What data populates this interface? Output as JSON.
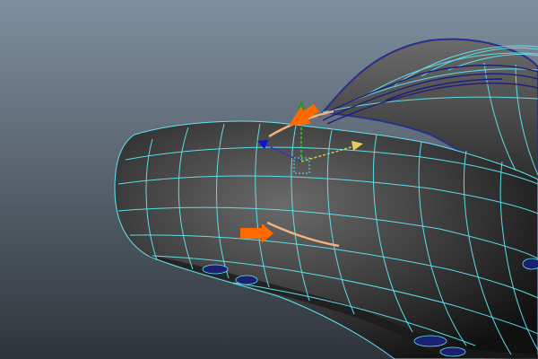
{
  "viewport": {
    "background_top": "#7f8f9f",
    "background_bottom": "#2f3439"
  },
  "mesh": {
    "object": "saddle-surface-mesh",
    "wireframe_color": "#5fe6f2",
    "shaded_color": "#4b4b4b",
    "selected_curve_color": "#f2b17f",
    "edge_highlight_color": "#2a2f8a",
    "annotation_arrow_color": "#ff6a00"
  },
  "manipulator": {
    "icon_y": "green-up-arrow-icon",
    "icon_x": "yellow-x-arrow-icon",
    "icon_z": "blue-z-arrow-icon",
    "pivot": "dotted-box-pivot-icon"
  }
}
